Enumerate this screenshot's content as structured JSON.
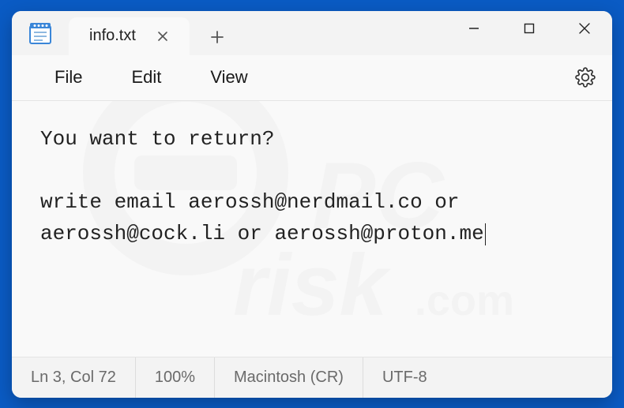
{
  "window": {
    "tab_title": "info.txt"
  },
  "menu": {
    "file": "File",
    "edit": "Edit",
    "view": "View"
  },
  "content": {
    "line1": "You want to return?",
    "line2": "",
    "line3": "write email aerossh@nerdmail.co or aerossh@cock.li or aerossh@proton.me"
  },
  "status": {
    "position": "Ln 3, Col 72",
    "zoom": "100%",
    "line_ending": "Macintosh (CR)",
    "encoding": "UTF-8"
  }
}
